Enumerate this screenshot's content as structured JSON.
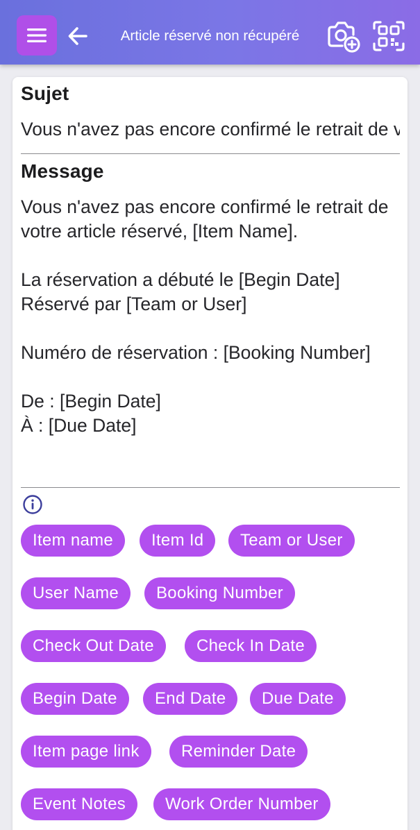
{
  "header": {
    "title": "Article réservé non récupéré",
    "menu_icon": "hamburger-menu-icon",
    "back_icon": "arrow-left-icon",
    "camera_icon": "camera-add-icon",
    "scan_icon": "qr-scan-icon",
    "gradient_start": "#6a70dd",
    "gradient_end": "#8b6ce6",
    "menu_color": "#b04fe8"
  },
  "form": {
    "subject_label": "Sujet",
    "subject_value": "Vous n'avez pas encore confirmé le retrait de votre article réservé",
    "message_label": "Message",
    "message_value": "Vous n'avez pas encore confirmé le retrait de votre article réservé, [Item Name].\n\nLa réservation a débuté le [Begin Date]\nRéservé par [Team or User]\n\nNuméro de réservation : [Booking Number]\n\nDe : [Begin Date]\nÀ : [Due Date]"
  },
  "info_icon": "info-circle-icon",
  "chip_color": "#b24fef",
  "chips": [
    "Item name",
    "Item Id",
    "Team or User",
    "User Name",
    "Booking Number",
    "Check Out Date",
    "Check In Date",
    "Begin Date",
    "End Date",
    "Due Date",
    "Item page link",
    "Reminder Date",
    "Event Notes",
    "Work Order Number"
  ]
}
